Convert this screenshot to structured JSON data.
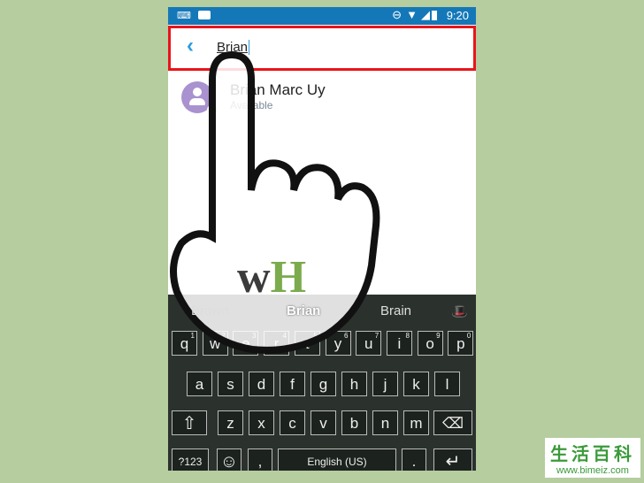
{
  "status_bar": {
    "time": "9:20"
  },
  "search": {
    "query": "Brian"
  },
  "contact": {
    "name": "Brian Marc Uy",
    "status": "Available"
  },
  "keyboard": {
    "suggestions": [
      "Brown",
      "Brian",
      "Brain"
    ],
    "row1": [
      [
        "q",
        "1"
      ],
      [
        "w",
        "2"
      ],
      [
        "e",
        "3"
      ],
      [
        "r",
        "4"
      ],
      [
        "t",
        "5"
      ],
      [
        "y",
        "6"
      ],
      [
        "u",
        "7"
      ],
      [
        "i",
        "8"
      ],
      [
        "o",
        "9"
      ],
      [
        "p",
        "0"
      ]
    ],
    "row2": [
      "a",
      "s",
      "d",
      "f",
      "g",
      "h",
      "j",
      "k",
      "l"
    ],
    "row3": [
      "z",
      "x",
      "c",
      "v",
      "b",
      "n",
      "m"
    ],
    "symbols": "?123",
    "space": "English (US)",
    "comma": ",",
    "period": "."
  },
  "logo": "wH",
  "watermark": {
    "title": "生活百科",
    "url": "www.bimeiz.com"
  },
  "colors": {
    "status": "#1478b8",
    "highlight": "#e8141b",
    "accent": "#2a9be0"
  }
}
